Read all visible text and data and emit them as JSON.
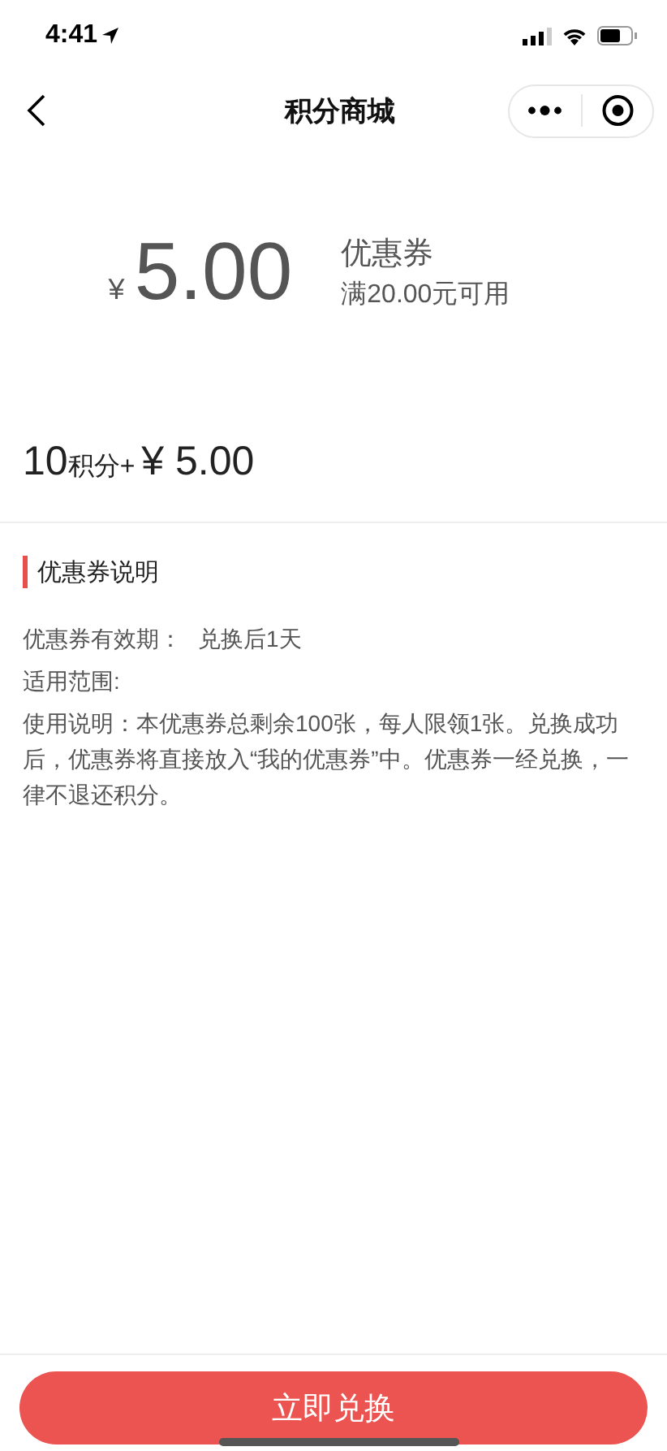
{
  "status_bar": {
    "time": "4:41"
  },
  "nav": {
    "title": "积分商城"
  },
  "coupon": {
    "currency": "¥",
    "amount": "5.00",
    "title": "优惠券",
    "condition": "满20.00元可用"
  },
  "price": {
    "points": "10",
    "points_unit": "积分+",
    "cash": "¥ 5.00"
  },
  "rules": {
    "title": "优惠券说明",
    "items": [
      {
        "label": "优惠券有效期：",
        "value": "兑换后1天"
      },
      {
        "label": "适用范围:"
      },
      {
        "label": "使用说明：本优惠券总剩余100张，每人限领1张。兑换成功后，优惠券将直接放入“我的优惠券”中。优惠券一经兑换，一律不退还积分。"
      }
    ]
  },
  "action": {
    "label": "立即兑换"
  }
}
